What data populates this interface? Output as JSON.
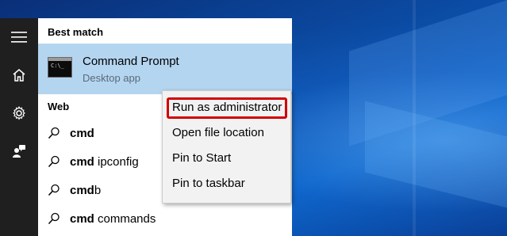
{
  "sidebar": {
    "items": [
      {
        "icon": "hamburger-menu-icon"
      },
      {
        "icon": "home-icon"
      },
      {
        "icon": "settings-gear-icon"
      },
      {
        "icon": "user-feedback-icon"
      }
    ]
  },
  "panel": {
    "best_match_title": "Best match",
    "best_match": {
      "name": "Command Prompt",
      "subtitle": "Desktop app",
      "icon": "command-prompt-icon"
    },
    "web_title": "Web",
    "web_results": [
      {
        "bold": "cmd",
        "rest": ""
      },
      {
        "bold": "cmd",
        "rest": " ipconfig"
      },
      {
        "bold": "cmd",
        "rest": "b"
      },
      {
        "bold": "cmd",
        "rest": " commands"
      }
    ]
  },
  "context_menu": {
    "items": [
      "Run as administrator",
      "Open file location",
      "Pin to Start",
      "Pin to taskbar"
    ],
    "highlighted": "Run as administrator",
    "highlight_color": "#d20000"
  },
  "colors": {
    "rail_bg": "#1f1f1f",
    "selection_bg": "#b4d5f0",
    "menu_bg": "#f2f2f2"
  }
}
